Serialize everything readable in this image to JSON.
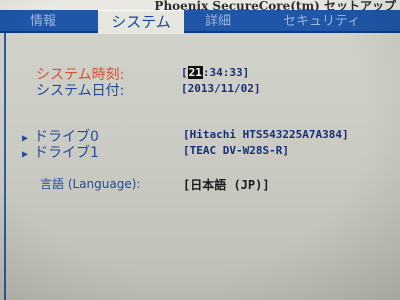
{
  "title": "Phoenix SecureCore(tm) セットアップ",
  "tabs": [
    {
      "label": "情報"
    },
    {
      "label": "システム"
    },
    {
      "label": "詳細"
    },
    {
      "label": "セキュリティ"
    }
  ],
  "settings": {
    "time": {
      "label": "システム時刻:",
      "cursor": "21",
      "rest": ":34:33",
      "open": "[",
      "close": "]"
    },
    "date": {
      "label": "システム日付:",
      "value": "[2013/11/02]"
    },
    "drive0": {
      "label": "ドライブ0",
      "value": "[Hitachi HTS543225A7A384]"
    },
    "drive1": {
      "label": "ドライブ1",
      "value": "[TEAC    DV-W28S-R]"
    },
    "language": {
      "label": "言語 (Language):",
      "value": "[日本語   (JP)]"
    }
  },
  "colors": {
    "tab_bar": "#1f56a8",
    "selected_label": "#d45238",
    "label": "#234a9e",
    "value": "#162f78"
  },
  "icons": {
    "drive_expand": "triangle-right-icon"
  }
}
